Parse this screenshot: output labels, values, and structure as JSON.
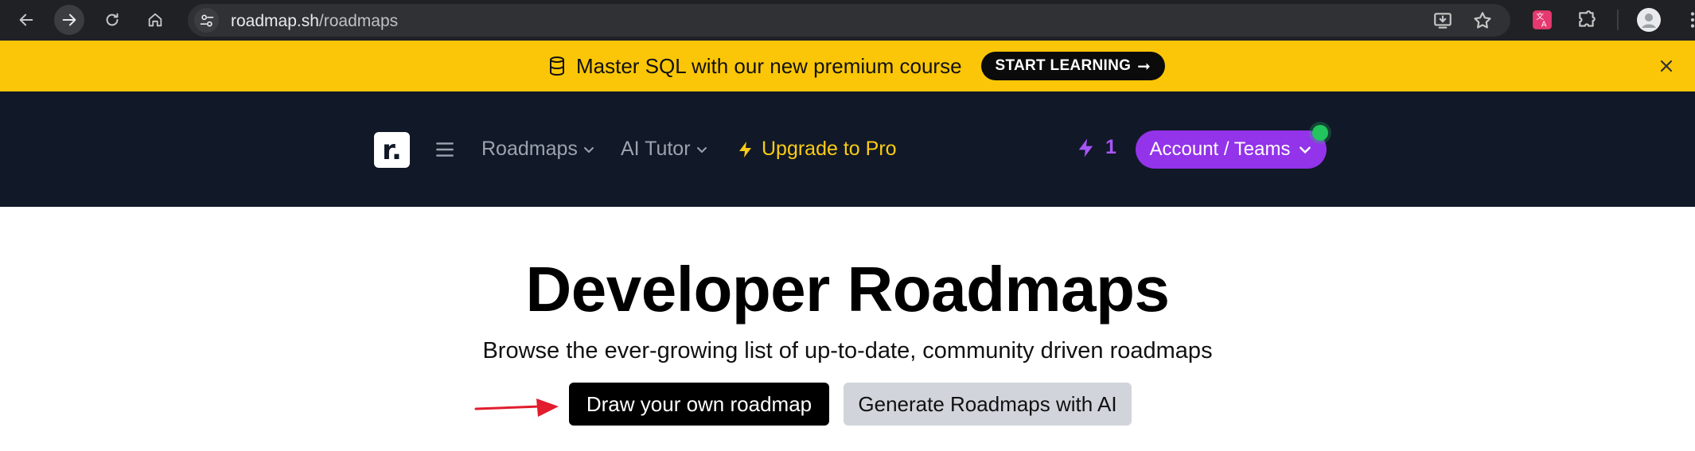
{
  "browser": {
    "url_host": "roadmap.sh",
    "url_path": "/roadmaps"
  },
  "banner": {
    "text": "Master SQL with our new premium course",
    "cta_label": "START LEARNING",
    "cta_arrow": "➞",
    "bg_color": "#fbc607"
  },
  "header": {
    "logo_text": "r.",
    "nav": {
      "roadmaps": "Roadmaps",
      "ai_tutor": "AI Tutor",
      "upgrade": "Upgrade to Pro"
    },
    "credits": "1",
    "account_label": "Account / Teams",
    "accent_color": "#9333ea"
  },
  "hero": {
    "title": "Developer Roadmaps",
    "subtitle": "Browse the ever-growing list of up-to-date, community driven roadmaps",
    "primary_button": "Draw your own roadmap",
    "secondary_button": "Generate Roadmaps with AI"
  }
}
